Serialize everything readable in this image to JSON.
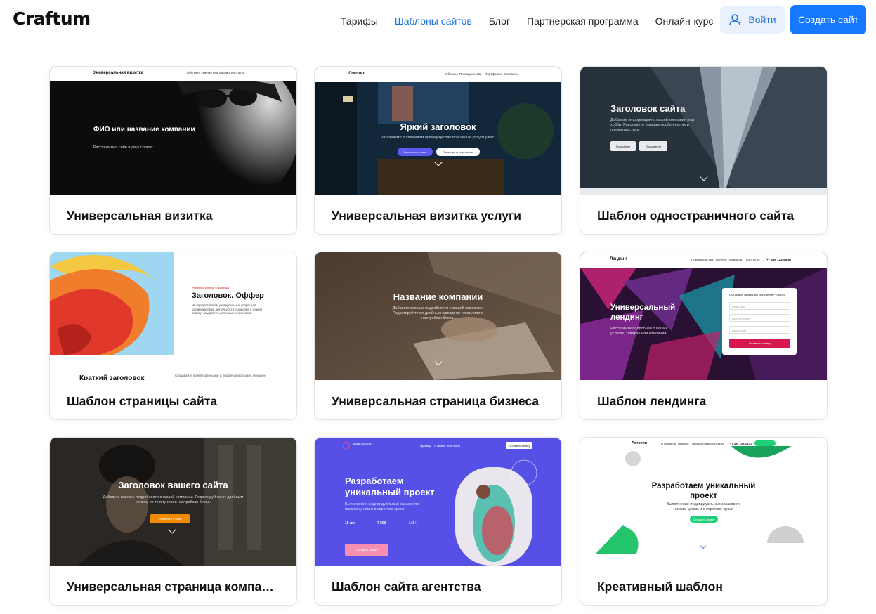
{
  "header": {
    "logo": "Craftum",
    "nav": [
      "Тарифы",
      "Шаблоны сайтов",
      "Блог",
      "Партнерская программа",
      "Онлайн-курс"
    ],
    "login_label": "Войти",
    "create_label": "Создать сайт"
  },
  "cards": [
    {
      "title": "Универсальная визитка",
      "preview": {
        "nav_logo": "Универсальная визитка",
        "nav_items": [
          "Обо мне",
          "Умения",
          "Портфолио",
          "Контакты"
        ],
        "heading": "ФИО или название компании",
        "sub": "Расскажите о себе в двух словах."
      }
    },
    {
      "title": "Универсальная визитка услуги",
      "preview": {
        "nav_logo": "Логотип",
        "nav_items": [
          "Обо мне",
          "Преимущества",
          "Портфолио",
          "Контакты"
        ],
        "heading": "Яркий заголовок",
        "sub": "Расскажите о ключевом преимуществе при заказе услуги у вас.",
        "btn1": "Связаться с нами",
        "btn2": "Посмотреть портфолио"
      }
    },
    {
      "title": "Шаблон одностраничного сайта",
      "preview": {
        "heading": "Заголовок сайта",
        "sub": "Добавьте информацию о вашей компании или хобби. Расскажите о ваших особенностях и преимуществах.",
        "btn1": "Подробнее",
        "btn2": "О компании"
      }
    },
    {
      "title": "Шаблон страницы сайта",
      "preview": {
        "kicker": "Универсальная страница",
        "heading": "Заголовок. Оффер",
        "sub": "Мы предоставляем универсальные услуги для различных сфер деятельности. Наш опыт и знания помогут вам достичь отличных результатов.",
        "bottom_heading": "Краткий заголовок",
        "bottom_sub": "Создавайте привлекательные и профессиональные лендинги"
      }
    },
    {
      "title": "Универсальная страница бизнеса",
      "preview": {
        "heading": "Название компании",
        "sub": "Добавьте важные подробности о вашей компании. Редактируй текст двойным кликом по тексту или в настройках блока."
      }
    },
    {
      "title": "Шаблон лендинга",
      "preview": {
        "nav_logo": "Лендинг",
        "nav_items": [
          "Преимущества",
          "Почему",
          "Команда",
          "Контакты",
          "+7 495 123-45-67"
        ],
        "heading": "Универсальный лендинг",
        "sub": "Расскажите подробнее о ваших услугах, товарах или компании.",
        "form_title": "Оставить заявку на получение услуги",
        "form_fields": [
          "Ваше имя",
          "Ваш телефон",
          "Ваш e-mail"
        ],
        "form_button": "Оставить заявку"
      }
    },
    {
      "title": "Универсальная страница компании",
      "preview": {
        "heading": "Заголовок вашего сайта",
        "sub": "Добавьте важные подробности о вашей компании. Редактируй текст двойным кликом по тексту или в настройках блока.",
        "btn1": "Связаться с нами"
      }
    },
    {
      "title": "Шаблон сайта агентства",
      "preview": {
        "nav_logo": "Ваш логотип",
        "nav_items": [
          "Пример",
          "Отзывы",
          "Контакты"
        ],
        "nav_button": "Оставить заявку",
        "heading": "Разработаем уникальный проект",
        "sub": "Выполнение индивидуальных заказов по низким ценам и в короткие сроки",
        "stats": [
          "15 лет",
          "7 500",
          "140+"
        ],
        "btn1": "Оставить заявку"
      }
    },
    {
      "title": "Креативный шаблон",
      "preview": {
        "nav_logo": "Логотип",
        "nav_items": [
          "О компании",
          "Новости",
          "Помощь",
          "Отзывы",
          "Контакты"
        ],
        "phone": "+7 495 123-45-67",
        "heading": "Разработаем уникальный проект",
        "sub": "Выполнение индивидуальных заказов по низким ценам и в короткие сроки",
        "btn1": "Оставить заявку"
      }
    }
  ]
}
